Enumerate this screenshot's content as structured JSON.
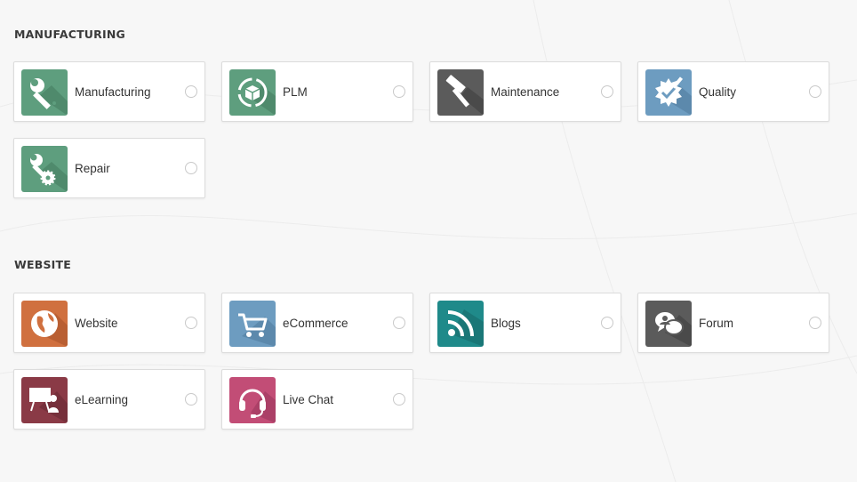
{
  "sections": {
    "manufacturing": {
      "title": "MANUFACTURING",
      "apps": [
        {
          "label": "Manufacturing",
          "icon": "wrench-icon",
          "color": "#5e9e7e"
        },
        {
          "label": "PLM",
          "icon": "cycle-box-icon",
          "color": "#5e9e7e"
        },
        {
          "label": "Maintenance",
          "icon": "hammer-icon",
          "color": "#5b5b5b"
        },
        {
          "label": "Quality",
          "icon": "quality-badge-icon",
          "color": "#6d9cc0"
        },
        {
          "label": "Repair",
          "icon": "wrench-gear-icon",
          "color": "#5e9e7e"
        }
      ]
    },
    "website": {
      "title": "WEBSITE",
      "apps": [
        {
          "label": "Website",
          "icon": "globe-icon",
          "color": "#d0703f"
        },
        {
          "label": "eCommerce",
          "icon": "cart-icon",
          "color": "#6d9cc0"
        },
        {
          "label": "Blogs",
          "icon": "rss-icon",
          "color": "#1f8a8a"
        },
        {
          "label": "Forum",
          "icon": "chat-bubbles-icon",
          "color": "#5b5b5b"
        },
        {
          "label": "eLearning",
          "icon": "presentation-icon",
          "color": "#8a3a46"
        },
        {
          "label": "Live Chat",
          "icon": "headset-icon",
          "color": "#c24d76"
        }
      ]
    }
  }
}
